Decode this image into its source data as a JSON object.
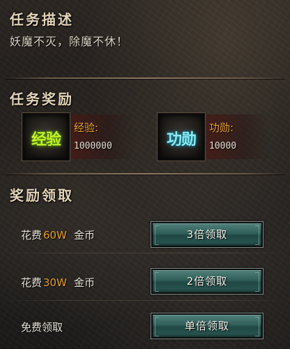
{
  "task_description": {
    "title": "任务描述",
    "text": "妖魔不灭，除魔不休！"
  },
  "task_rewards": {
    "title": "任务奖励",
    "items": [
      {
        "icon": "exp-icon",
        "art_text": "经验",
        "label": "经验:",
        "value": "1000000"
      },
      {
        "icon": "merit-icon",
        "art_text": "功勋",
        "label": "功勋:",
        "value": "10000"
      }
    ]
  },
  "reward_claim": {
    "title": "奖励领取",
    "options": [
      {
        "prefix": "花费",
        "amount": "60W",
        "suffix": "金币",
        "button": "3倍领取"
      },
      {
        "prefix": "花费",
        "amount": "30W",
        "suffix": "金币",
        "button": "2倍领取"
      },
      {
        "prefix": "免费领取",
        "amount": "",
        "suffix": "",
        "button": "单倍领取"
      }
    ]
  },
  "colors": {
    "title": "#e2d4b8",
    "label_orange": "#e7a12c",
    "amount_orange": "#e49b2b",
    "button_teal": "#2f5e59"
  }
}
